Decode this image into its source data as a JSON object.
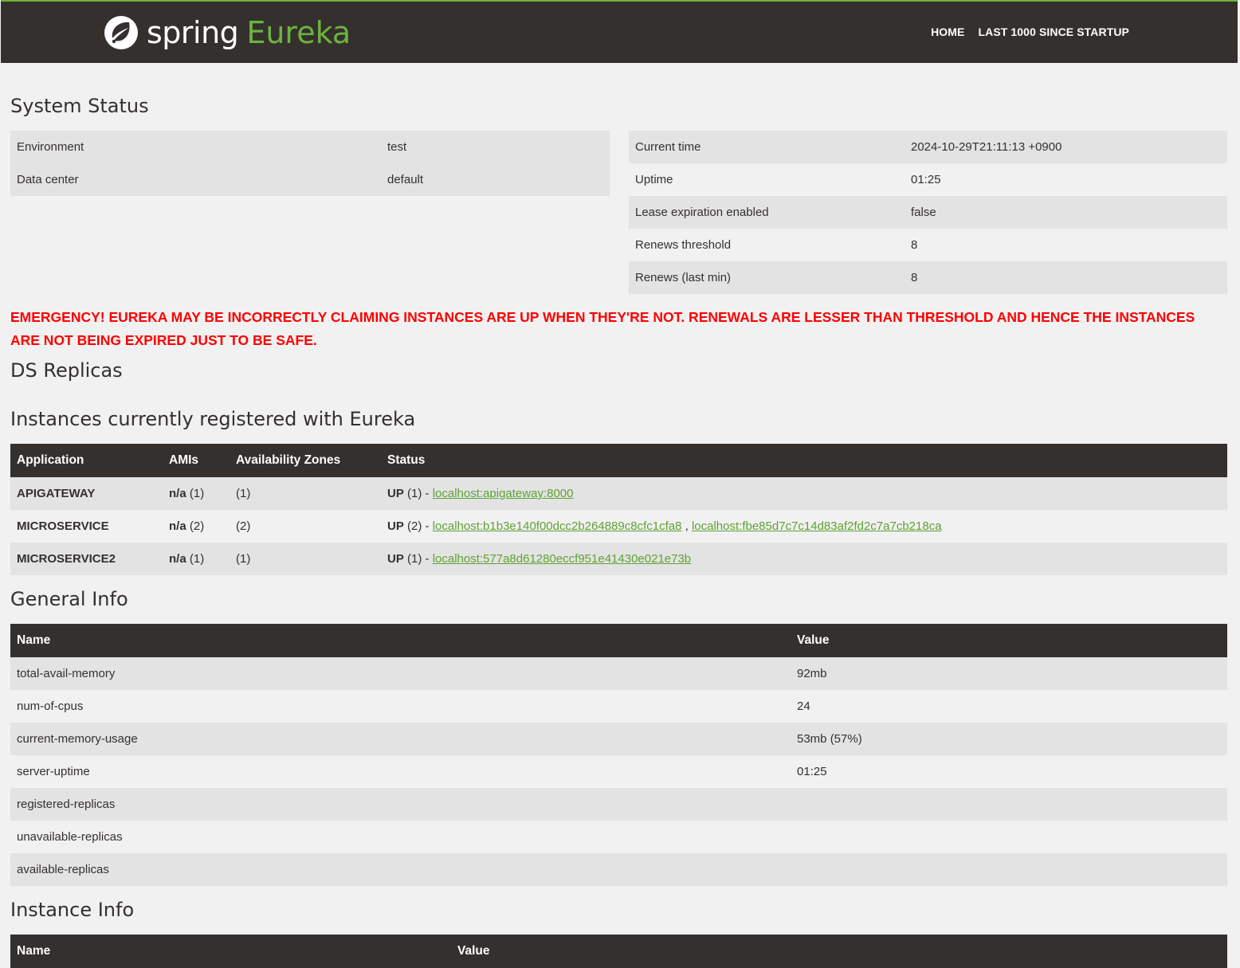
{
  "header": {
    "brand_spring": "spring",
    "brand_eureka": "Eureka",
    "nav": [
      "HOME",
      "LAST 1000 SINCE STARTUP"
    ]
  },
  "system_status": {
    "title": "System Status",
    "left": [
      {
        "label": "Environment",
        "value": "test"
      },
      {
        "label": "Data center",
        "value": "default"
      }
    ],
    "right": [
      {
        "label": "Current time",
        "value": "2024-10-29T21:11:13 +0900"
      },
      {
        "label": "Uptime",
        "value": "01:25"
      },
      {
        "label": "Lease expiration enabled",
        "value": "false"
      },
      {
        "label": "Renews threshold",
        "value": "8"
      },
      {
        "label": "Renews (last min)",
        "value": "8"
      }
    ]
  },
  "emergency": "EMERGENCY! EUREKA MAY BE INCORRECTLY CLAIMING INSTANCES ARE UP WHEN THEY'RE NOT. RENEWALS ARE LESSER THAN THRESHOLD AND HENCE THE INSTANCES ARE NOT BEING EXPIRED JUST TO BE SAFE.",
  "ds_replicas": {
    "title": "DS Replicas"
  },
  "instances": {
    "title": "Instances currently registered with Eureka",
    "columns": [
      "Application",
      "AMIs",
      "Availability Zones",
      "Status"
    ],
    "rows": [
      {
        "app": "APIGATEWAY",
        "ami_bold": "n/a",
        "ami_count": " (1)",
        "zones": "(1)",
        "status_bold": "UP",
        "status_count": " (1) - ",
        "links": [
          "localhost:apigateway:8000"
        ]
      },
      {
        "app": "MICROSERVICE",
        "ami_bold": "n/a",
        "ami_count": " (2)",
        "zones": "(2)",
        "status_bold": "UP",
        "status_count": " (2) - ",
        "links": [
          "localhost:b1b3e140f00dcc2b264889c8cfc1cfa8",
          "localhost:fbe85d7c7c14d83af2fd2c7a7cb218ca"
        ]
      },
      {
        "app": "MICROSERVICE2",
        "ami_bold": "n/a",
        "ami_count": " (1)",
        "zones": "(1)",
        "status_bold": "UP",
        "status_count": " (1) - ",
        "links": [
          "localhost:577a8d61280eccf951e41430e021e73b"
        ]
      }
    ],
    "link_separator": " , "
  },
  "general_info": {
    "title": "General Info",
    "columns": [
      "Name",
      "Value"
    ],
    "rows": [
      {
        "name": "total-avail-memory",
        "value": "92mb"
      },
      {
        "name": "num-of-cpus",
        "value": "24"
      },
      {
        "name": "current-memory-usage",
        "value": "53mb (57%)"
      },
      {
        "name": "server-uptime",
        "value": "01:25"
      },
      {
        "name": "registered-replicas",
        "value": ""
      },
      {
        "name": "unavailable-replicas",
        "value": ""
      },
      {
        "name": "available-replicas",
        "value": ""
      }
    ]
  },
  "instance_info": {
    "title": "Instance Info",
    "columns": [
      "Name",
      "Value"
    ]
  },
  "colors": {
    "header_bg": "#34302d",
    "brand_green": "#6db33f",
    "emergency": "#ff0000"
  }
}
